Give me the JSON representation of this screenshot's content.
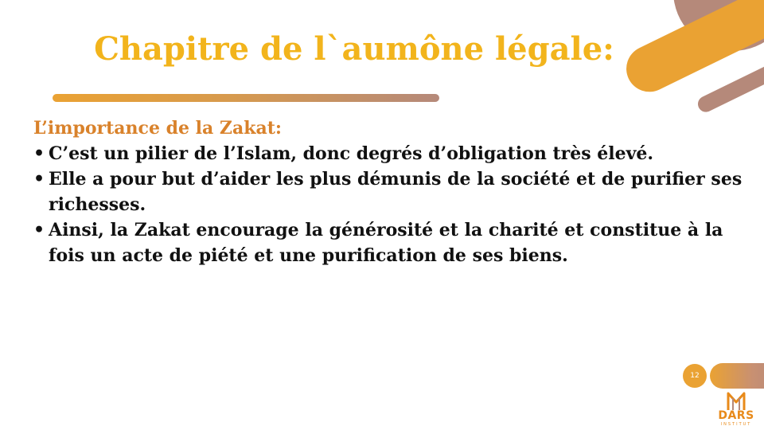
{
  "slide": {
    "title": "Chapitre de l`aumône légale:",
    "subheading": "L’importance de la Zakat:",
    "bullets": [
      "C’est un pilier de l’Islam, donc degrés d’obligation très élevé.",
      "Elle a pour but d’aider les plus démunis de la société et de purifier ses richesses.",
      "Ainsi, la Zakat encourage la générosité et la charité et constitue à la fois un acte de piété et une purification de ses biens."
    ],
    "bullet_glyph": "•",
    "page_number": "12"
  },
  "logo": {
    "name": "DARS",
    "subtitle": "INSTITUT"
  },
  "colors": {
    "title": "#f2b41c",
    "subheading": "#d9822b",
    "accent_orange": "#eaa233",
    "accent_brown": "#b5897a",
    "body_text": "#111111"
  }
}
